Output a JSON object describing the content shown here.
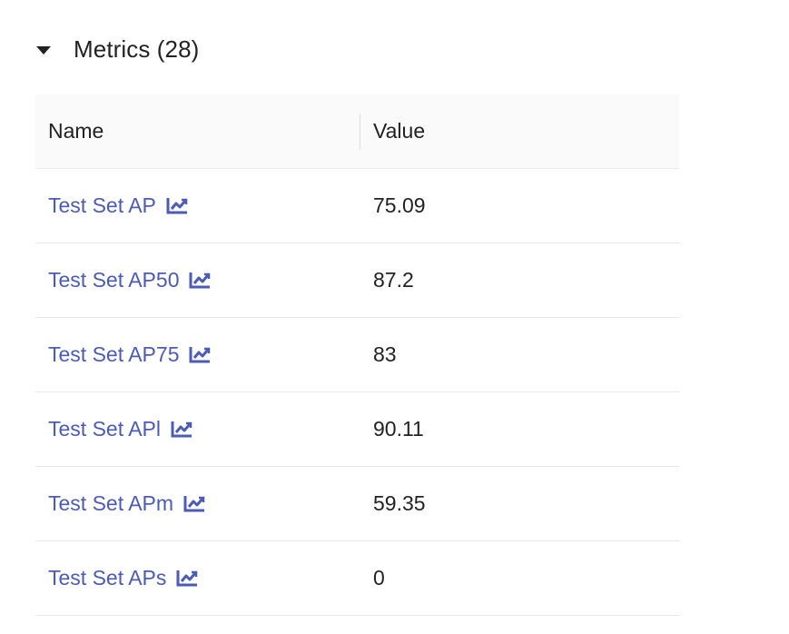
{
  "section": {
    "title": "Metrics (28)"
  },
  "table": {
    "columns": [
      "Name",
      "Value"
    ],
    "rows": [
      {
        "name": "Test Set AP",
        "value": "75.09"
      },
      {
        "name": "Test Set AP50",
        "value": "87.2"
      },
      {
        "name": "Test Set AP75",
        "value": "83"
      },
      {
        "name": "Test Set APl",
        "value": "90.11"
      },
      {
        "name": "Test Set APm",
        "value": "59.35"
      },
      {
        "name": "Test Set APs",
        "value": "0"
      }
    ]
  },
  "icons": {
    "row_icon": "line-chart-icon",
    "toggle_icon": "caret-down-icon"
  },
  "colors": {
    "link": "#4c5bb5",
    "text": "#222222",
    "header_bg": "#fafafa"
  }
}
